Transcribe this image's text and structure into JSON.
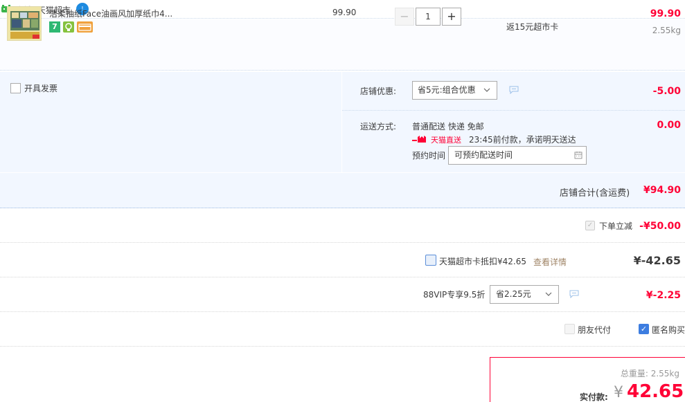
{
  "shop": {
    "name": "店铺: 天猫超市",
    "ww_badge": "!"
  },
  "item": {
    "title": "洁柔抽纸Face油画风加厚纸巾4...",
    "badge_seven": "7",
    "unit_price": "99.90",
    "quantity": "1",
    "minus_symbol": "−",
    "plus_symbol": "+",
    "rebate": "返15元超市卡",
    "total": "99.90",
    "weight": "2.55kg"
  },
  "service": {
    "invoice_label": "开具发票",
    "coupon_label": "店铺优惠:",
    "coupon_selected": "省5元:组合优惠",
    "coupon_amount": "-5.00",
    "ship_label": "运送方式:",
    "ship_method": "普通配送 快递 免邮",
    "tmall_direct": "天猫直送",
    "ship_promise": "23:45前付款，承诺明天送达",
    "reserve_label": "预约时间",
    "reserve_placeholder": "可预约配送时间",
    "ship_amount": "0.00"
  },
  "shop_total": {
    "label": "店铺合计(含运费)",
    "amount": "¥94.90"
  },
  "discounts": {
    "instant_label": "下单立减",
    "instant_check": "✓",
    "instant_amount": "-¥50.00",
    "card_label": "天猫超市卡抵扣¥42.65",
    "card_link": "查看详情",
    "card_amount": "¥-42.65",
    "vip_label": "88VIP专享9.5折",
    "vip_selected": "省2.25元",
    "vip_amount": "¥-2.25"
  },
  "options": {
    "friend_pay": "朋友代付",
    "anonymous": "匿名购买",
    "anon_check": "✓"
  },
  "pay": {
    "weight_label": "总重量: 2.55kg",
    "pay_label": "实付款:",
    "currency": "¥",
    "amount": "42.65"
  },
  "colors": {
    "price_red": "#ff0036",
    "light_blue_bg": "#f2f7ff",
    "link_brown": "#a08567",
    "checkbox_blue": "#3d7de0"
  }
}
